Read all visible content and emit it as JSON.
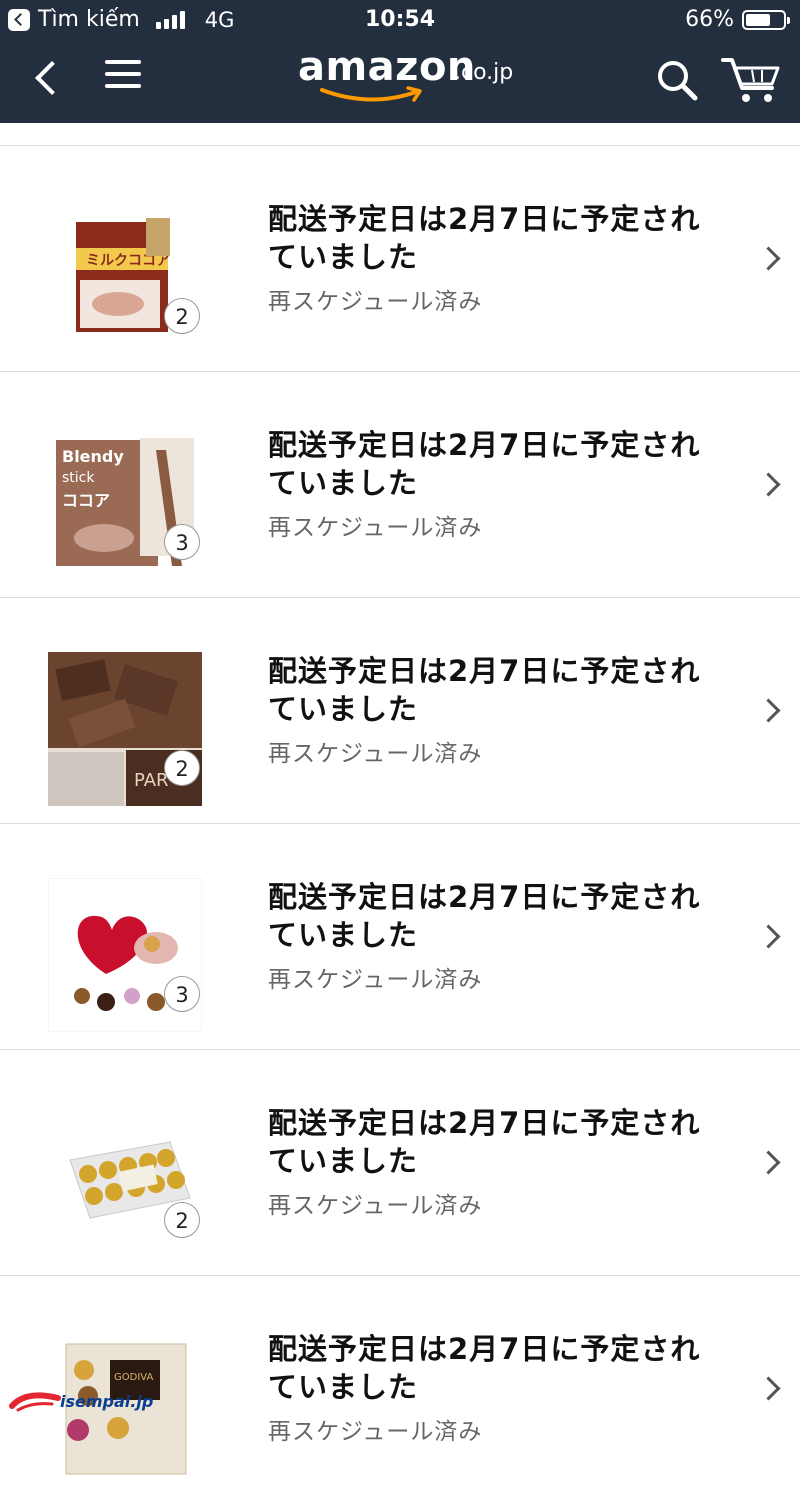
{
  "status_bar": {
    "back_app": "Tìm kiếm",
    "network": "4G",
    "time": "10:54",
    "battery": "66%",
    "battery_level": 0.66
  },
  "nav": {
    "logo": "amazon",
    "logo_tld": ".co.jp",
    "icons": [
      "back-icon",
      "menu-icon",
      "search-icon",
      "cart-icon"
    ]
  },
  "orders": [
    {
      "title": "配送予定日は2月7日に予定されていました",
      "status": "再スケジュール済み",
      "quantity": "2",
      "image": "milk-cocoa-box"
    },
    {
      "title": "配送予定日は2月7日に予定されていました",
      "status": "再スケジュール済み",
      "quantity": "3",
      "image": "blendy-cocoa-box"
    },
    {
      "title": "配送予定日は2月7日に予定されていました",
      "status": "再スケジュール済み",
      "quantity": "2",
      "image": "chocolate-pieces"
    },
    {
      "title": "配送予定日は2月7日に予定されていました",
      "status": "再スケジュール済み",
      "quantity": "3",
      "image": "heart-chocolate-box"
    },
    {
      "title": "配送予定日は2月7日に予定されていました",
      "status": "再スケジュール済み",
      "quantity": "2",
      "image": "ferrero-rocher-box"
    },
    {
      "title": "配送予定日は2月7日に予定されていました",
      "status": "再スケジュール済み",
      "quantity": "",
      "image": "godiva-box"
    }
  ],
  "watermark": "isempai.jp",
  "colors": {
    "topbar": "#232f3e",
    "logo_smile": "#f90",
    "background": "#ffffff"
  }
}
